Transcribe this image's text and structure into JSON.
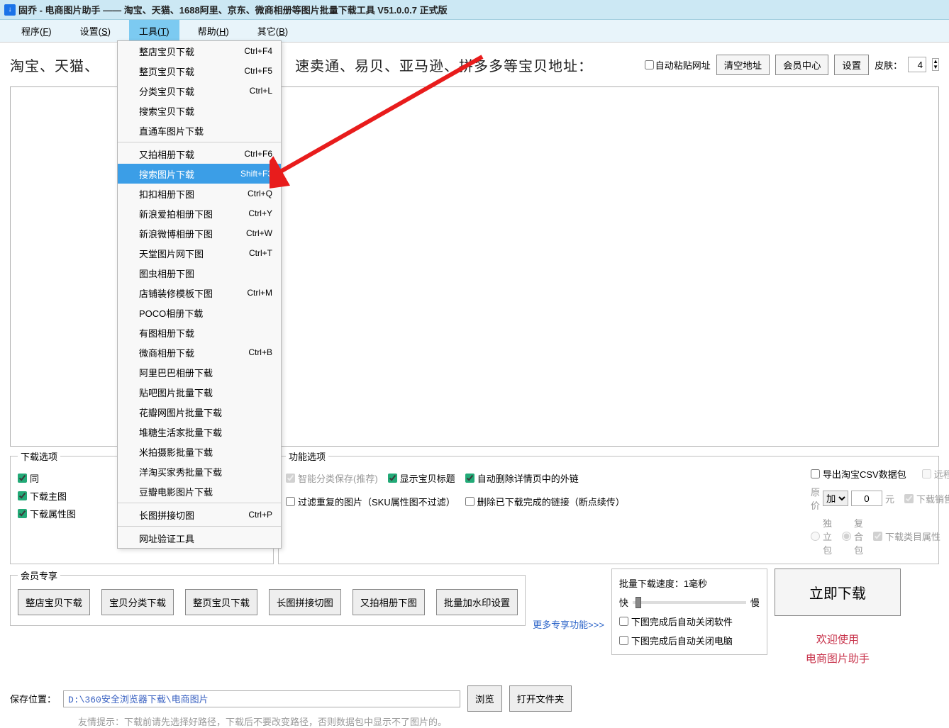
{
  "title": "固乔 - 电商图片助手 —— 淘宝、天猫、1688阿里、京东、微商相册等图片批量下载工具 V51.0.0.7 正式版",
  "app_icon": "↓",
  "menubar": [
    {
      "label": "程序",
      "hotkey": "F"
    },
    {
      "label": "设置",
      "hotkey": "S"
    },
    {
      "label": "工具",
      "hotkey": "T",
      "open": true
    },
    {
      "label": "帮助",
      "hotkey": "H"
    },
    {
      "label": "其它",
      "hotkey": "B"
    }
  ],
  "dropdown": [
    {
      "label": "整店宝贝下载",
      "shortcut": "Ctrl+F4"
    },
    {
      "label": "整页宝贝下载",
      "shortcut": "Ctrl+F5"
    },
    {
      "label": "分类宝贝下载",
      "shortcut": "Ctrl+L"
    },
    {
      "label": "搜索宝贝下载"
    },
    {
      "label": "直通车图片下载"
    },
    {
      "sep": true
    },
    {
      "label": "又拍相册下载",
      "shortcut": "Ctrl+F6"
    },
    {
      "label": "搜索图片下载",
      "shortcut": "Shift+F3",
      "selected": true
    },
    {
      "label": "扣扣相册下图",
      "shortcut": "Ctrl+Q"
    },
    {
      "label": "新浪爱拍相册下图",
      "shortcut": "Ctrl+Y"
    },
    {
      "label": "新浪微博相册下图",
      "shortcut": "Ctrl+W"
    },
    {
      "label": "天堂图片网下图",
      "shortcut": "Ctrl+T"
    },
    {
      "label": "图虫相册下图"
    },
    {
      "label": "店铺装修模板下图",
      "shortcut": "Ctrl+M"
    },
    {
      "label": "POCO相册下载"
    },
    {
      "label": "有图相册下载"
    },
    {
      "label": "微商相册下载",
      "shortcut": "Ctrl+B"
    },
    {
      "label": "阿里巴巴相册下载"
    },
    {
      "label": "贴吧图片批量下载"
    },
    {
      "label": "花瓣网图片批量下载"
    },
    {
      "label": "堆糖生活家批量下载"
    },
    {
      "label": "米拍摄影批量下载"
    },
    {
      "label": "洋淘买家秀批量下载"
    },
    {
      "label": "豆瓣电影图片下载"
    },
    {
      "sep": true
    },
    {
      "label": "长图拼接切图",
      "shortcut": "Ctrl+P"
    },
    {
      "sep": true
    },
    {
      "label": "网址验证工具"
    }
  ],
  "addrbar": {
    "label_left": "淘宝、天猫、",
    "label_right": "速卖通、易贝、亚马逊、拼多多等宝贝地址：",
    "auto_paste": "自动粘贴网址",
    "btn_clear": "清空地址",
    "btn_member": "会员中心",
    "btn_settings": "设置",
    "skin_label": "皮肤：",
    "skin_value": "4"
  },
  "download_opts": {
    "legend": "下载选项",
    "same": "同",
    "main": "下载主图",
    "attr": "下载属性图"
  },
  "func_opts": {
    "legend": "功能选项",
    "smart": "智能分类保存(推荐)",
    "show_title": "显示宝贝标题",
    "auto_del_links": "自动删除详情页中的外链",
    "filter_dup": "过滤重复的图片（SKU属性图不过滤）",
    "del_done": "删除已下载完成的链接（断点续传）"
  },
  "export": {
    "csv": "导出淘宝CSV数据包",
    "remote": "远程详情图",
    "price_label_pre": "原价",
    "price_op": "加",
    "price_val": "0",
    "price_unit": "元",
    "sale_attr": "下载销售属性",
    "single": "独立包",
    "combo": "复合包",
    "cat_attr": "下载类目属性"
  },
  "member": {
    "legend": "会员专享",
    "b1": "整店宝贝下载",
    "b2": "宝贝分类下载",
    "b3": "整页宝贝下载",
    "b4": "长图拼接切图",
    "b5": "又拍相册下图",
    "b6": "批量加水印设置",
    "more": "更多专享功能>>>"
  },
  "speed": {
    "label": "批量下载速度：1毫秒",
    "fast": "快",
    "slow": "慢",
    "close_soft": "下图完成后自动关闭软件",
    "close_pc": "下图完成后自动关闭电脑"
  },
  "bigdl": "立即下载",
  "welcome": {
    "w1": "欢迎使用",
    "w2": "电商图片助手"
  },
  "save": {
    "label": "保存位置：",
    "path": "D:\\360安全浏览器下载\\电商图片",
    "browse": "浏览",
    "open": "打开文件夹"
  },
  "hint": "友情提示：下载前请先选择好路径，下载后不要改变路径，否则数据包中显示不了图片的。"
}
